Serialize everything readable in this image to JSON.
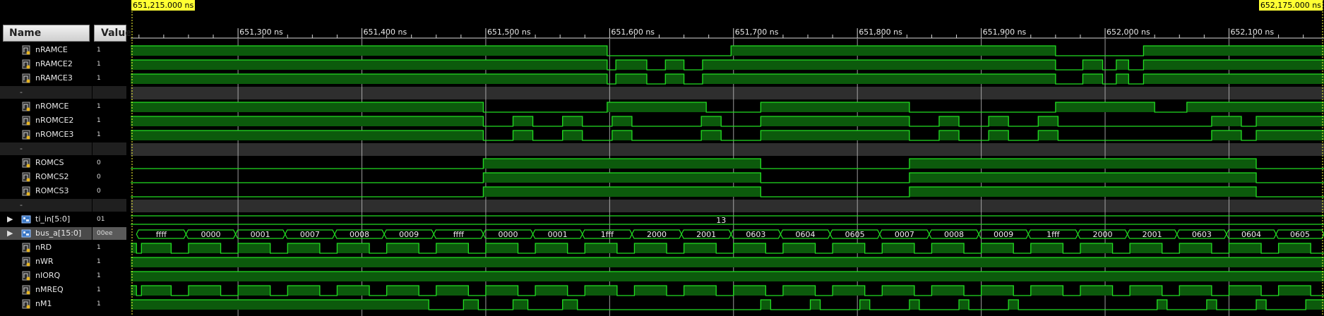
{
  "columns": {
    "name": "Name",
    "value": "Value"
  },
  "cursors": {
    "left": "651,215.000 ns",
    "right": "652,175.000 ns"
  },
  "time_ticks": [
    "651,300 ns",
    "651,400 ns",
    "651,500 ns",
    "651,600 ns",
    "651,700 ns",
    "651,800 ns",
    "651,900 ns",
    "652,000 ns",
    "652,100 ns"
  ],
  "signals": [
    {
      "name": "nRAMCE",
      "value": "1",
      "kind": "bit"
    },
    {
      "name": "nRAMCE2",
      "value": "1",
      "kind": "bit"
    },
    {
      "name": "nRAMCE3",
      "value": "1",
      "kind": "bit"
    },
    {
      "name": "-",
      "value": "",
      "kind": "divider"
    },
    {
      "name": "nROMCE",
      "value": "1",
      "kind": "bit"
    },
    {
      "name": "nROMCE2",
      "value": "1",
      "kind": "bit"
    },
    {
      "name": "nROMCE3",
      "value": "1",
      "kind": "bit"
    },
    {
      "name": "-",
      "value": "",
      "kind": "divider"
    },
    {
      "name": "ROMCS",
      "value": "0",
      "kind": "bit"
    },
    {
      "name": "ROMCS2",
      "value": "0",
      "kind": "bit"
    },
    {
      "name": "ROMCS3",
      "value": "0",
      "kind": "bit"
    },
    {
      "name": "-",
      "value": "",
      "kind": "divider"
    },
    {
      "name": "ti_in[5:0]",
      "value": "01",
      "kind": "bus"
    },
    {
      "name": "bus_a[15:0]",
      "value": "00ee",
      "kind": "bus"
    },
    {
      "name": "nRD",
      "value": "1",
      "kind": "bit"
    },
    {
      "name": "nWR",
      "value": "1",
      "kind": "bit"
    },
    {
      "name": "nIORQ",
      "value": "1",
      "kind": "bit"
    },
    {
      "name": "nMREQ",
      "value": "1",
      "kind": "bit"
    },
    {
      "name": "nM1",
      "value": "1",
      "kind": "bit"
    }
  ],
  "ti_in_value": "13",
  "bus_a_values": [
    "ffff",
    "0000",
    "0001",
    "0007",
    "0008",
    "0009",
    "ffff",
    "0000",
    "0001",
    "1fff",
    "2000",
    "2001",
    "0603",
    "0604",
    "0605",
    "0007",
    "0008",
    "0009",
    "1fff",
    "2000",
    "2001",
    "0603",
    "0604",
    "0605"
  ],
  "colors": {
    "wave": "#22dd22",
    "fill": "#0c5a0c",
    "divider": "#2e2e2e",
    "grid": "#cfcfcf",
    "cursor": "#ffff33"
  }
}
